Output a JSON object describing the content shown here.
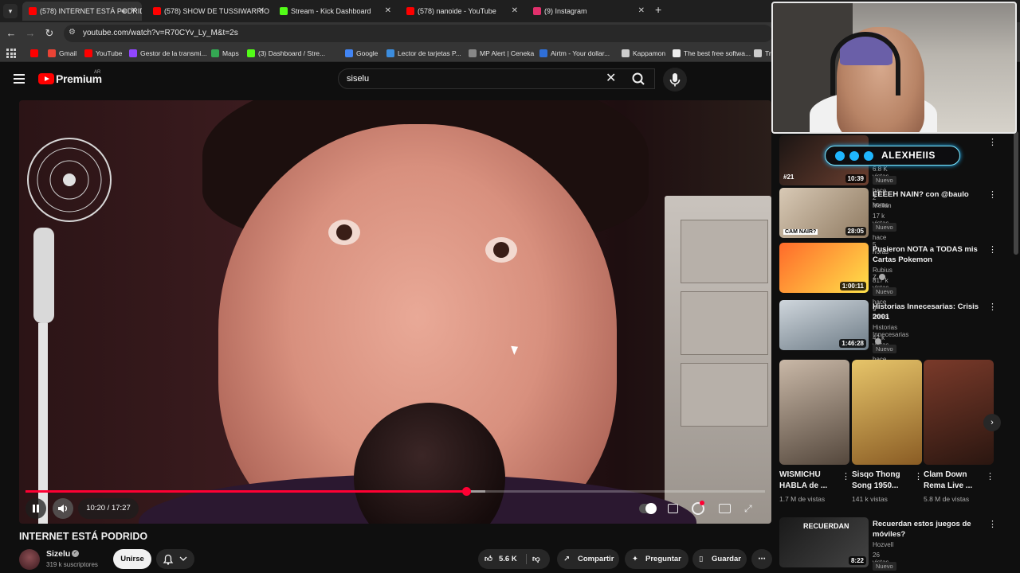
{
  "browser": {
    "tabs": [
      {
        "label": "(578) INTERNET ESTÁ PODRIDO",
        "favicon_color": "#ff0000",
        "active": true,
        "audio": true
      },
      {
        "label": "(578) SHOW DE TUSSIWARRIORS",
        "favicon_color": "#ff0000"
      },
      {
        "label": "Stream - Kick Dashboard",
        "favicon_color": "#53fc18"
      },
      {
        "label": "(578) nanoide - YouTube",
        "favicon_color": "#ff0000"
      },
      {
        "label": "(9) Instagram",
        "favicon_color": "#e1306c"
      }
    ],
    "url": "youtube.com/watch?v=R70CYv_Ly_M&t=2s",
    "bookmarks": [
      {
        "label": "",
        "color": "#ff0000"
      },
      {
        "label": "Gmail",
        "color": "#ea4335"
      },
      {
        "label": "YouTube",
        "color": "#ff0000"
      },
      {
        "label": "Gestor de la transmi...",
        "color": "#9146ff"
      },
      {
        "label": "Maps",
        "color": "#34a853"
      },
      {
        "label": "(3) Dashboard / Stre...",
        "color": "#53fc18"
      },
      {
        "label": "Google",
        "color": "#4285f4"
      },
      {
        "label": "Lector de tarjetas P...",
        "color": "#3c8dde"
      },
      {
        "label": "MP Alert | Ceneka",
        "color": "#888888"
      },
      {
        "label": "Airtm - Your dollar...",
        "color": "#2f6fd8"
      },
      {
        "label": "Kappamon",
        "color": "#cccccc"
      },
      {
        "label": "The best free softwa...",
        "color": "#eeeeee"
      },
      {
        "label": "Tr",
        "color": "#cccccc"
      }
    ]
  },
  "youtube": {
    "brand": "Premium",
    "country": "AR",
    "search": {
      "value": "siselu"
    }
  },
  "player": {
    "current_time": "10:20",
    "duration": "17:27",
    "time_label": "10:20 / 17:27",
    "progress_fraction": 0.596,
    "buffer_fraction": 0.622
  },
  "video": {
    "title": "INTERNET ESTÁ PODRIDO",
    "channel": "Sizelu",
    "subscribers": "319 k suscriptores",
    "join_label": "Unirse",
    "likes": "5.6 K",
    "share_label": "Compartir",
    "ask_label": "Preguntar",
    "save_label": "Guardar"
  },
  "overlay": {
    "streamer_name": "ALEXHEIIS",
    "rank": "#21"
  },
  "sidebar": {
    "items": [
      {
        "title": "",
        "channel": "",
        "meta": "6.8 K vistas · hace 2 horas",
        "badge": "Nuevo",
        "duration": "10:39",
        "thumb": [
          "#1b1513",
          "#6b3f30"
        ]
      },
      {
        "title": "EEEEH NAIN? con @baulo",
        "channel": "Melian",
        "meta": "17 k vistas · hace 5 horas",
        "badge": "Nuevo",
        "duration": "28:05",
        "thumb": [
          "#d8c9b5",
          "#8f7a61"
        ],
        "thumb_text": "CAM NAIR?"
      },
      {
        "title": "Pusieron NOTA a TODAS mis Cartas Pokemon",
        "channel": "Rubius Z",
        "verified": true,
        "meta": "817 k vistas · hace 9 horas",
        "badge": "Nuevo",
        "duration": "1:00:11",
        "thumb": [
          "#ff6a2a",
          "#ffe14a"
        ]
      },
      {
        "title": "Historias Innecesarias: Crisis 2001",
        "channel": "Historias Innecesarias",
        "verified": true,
        "meta": "42 k vistas · hace 2 horas",
        "badge": "Nuevo",
        "duration": "1:46:28",
        "thumb": [
          "#cfd6dc",
          "#6d7b86"
        ]
      },
      {
        "title": "Recuerdan estos juegos de móviles?",
        "channel": "Hozvell",
        "meta": "26 vistas · hace 6 horas",
        "badge": "Nuevo",
        "duration": "8:22",
        "thumb": [
          "#1a1a1a",
          "#444444"
        ],
        "thumb_text": "RECUERDAN"
      }
    ],
    "shorts": [
      {
        "title": "WISMICHU HABLA de ...",
        "views": "1.7 M de vistas",
        "thumb": [
          "#c9b8a7",
          "#54473c"
        ]
      },
      {
        "title": "Sisqo Thong Song 1950...",
        "views": "141 k vistas",
        "thumb": [
          "#e7c56a",
          "#8a5c24"
        ]
      },
      {
        "title": "Clam Down Rema Live ...",
        "views": "5.8 M de vistas",
        "thumb": [
          "#7a3a2a",
          "#2a1610"
        ]
      }
    ]
  }
}
